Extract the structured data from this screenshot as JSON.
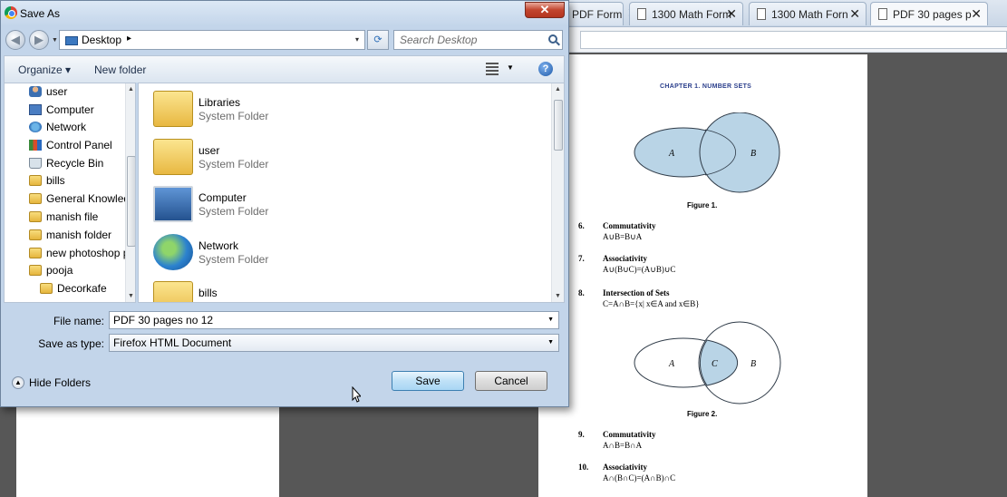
{
  "browser": {
    "tabs": [
      {
        "title": "PDF Form",
        "close": "✕"
      },
      {
        "title": "1300 Math Form",
        "close": "✕"
      },
      {
        "title": "1300 Math Forn",
        "close": "✕"
      },
      {
        "title": "PDF 30 pages p",
        "close": "✕"
      }
    ]
  },
  "pdf": {
    "chapter_heading": "CHAPTER 1. NUMBER SETS",
    "figure1": {
      "label_a": "A",
      "label_b": "B",
      "caption": "Figure 1."
    },
    "figure2": {
      "label_a": "A",
      "label_c": "C",
      "label_b": "B",
      "caption": "Figure 2."
    },
    "items": [
      {
        "num": "6.",
        "title": "Commutativity",
        "formula": "A∪B=B∪A"
      },
      {
        "num": "7.",
        "title": "Associativity",
        "formula": "A∪(B∪C)=(A∪B)∪C"
      },
      {
        "num": "8.",
        "title": "Intersection of Sets",
        "formula": "C=A∩B={x| x∈A and x∈B}"
      },
      {
        "num": "9.",
        "title": "Commutativity",
        "formula": "A∩B=B∩A"
      },
      {
        "num": "10.",
        "title": "Associativity",
        "formula": "A∩(B∩C)=(A∩B)∩C"
      }
    ]
  },
  "dialog": {
    "title": "Save As",
    "close_glyph": "✕",
    "address": {
      "location": "Desktop",
      "separator": "▸",
      "drop": "▾"
    },
    "search_placeholder": "Search Desktop",
    "toolbar": {
      "organize": "Organize ▾",
      "new_folder": "New folder",
      "views_drop": "▼",
      "help": "?"
    },
    "nav_items": [
      {
        "label": "user",
        "icon": "user-icon"
      },
      {
        "label": "Computer",
        "icon": "computer-icon"
      },
      {
        "label": "Network",
        "icon": "network-icon"
      },
      {
        "label": "Control Panel",
        "icon": "control-panel-icon"
      },
      {
        "label": "Recycle Bin",
        "icon": "recycle-bin-icon"
      },
      {
        "label": "bills",
        "icon": "folder-icon"
      },
      {
        "label": "General Knowled",
        "icon": "folder-icon"
      },
      {
        "label": "manish file",
        "icon": "folder-icon"
      },
      {
        "label": "manish folder",
        "icon": "folder-icon"
      },
      {
        "label": "new photoshop p",
        "icon": "folder-icon"
      },
      {
        "label": "pooja",
        "icon": "folder-icon"
      },
      {
        "label": "Decorkafe",
        "icon": "folder-icon"
      }
    ],
    "files": [
      {
        "name": "Libraries",
        "type": "System Folder",
        "icon": "libraries-icon"
      },
      {
        "name": "user",
        "type": "System Folder",
        "icon": "user-folder-icon"
      },
      {
        "name": "Computer",
        "type": "System Folder",
        "icon": "computer-icon"
      },
      {
        "name": "Network",
        "type": "System Folder",
        "icon": "network-icon"
      },
      {
        "name": "bills",
        "type": "",
        "icon": "folder-icon"
      }
    ],
    "file_name_label": "File name:",
    "file_name_value": "PDF 30 pages  no 12",
    "save_type_label": "Save as type:",
    "save_type_value": "Firefox HTML Document",
    "hide_folders": "Hide Folders",
    "save_button": "Save",
    "cancel_button": "Cancel"
  }
}
